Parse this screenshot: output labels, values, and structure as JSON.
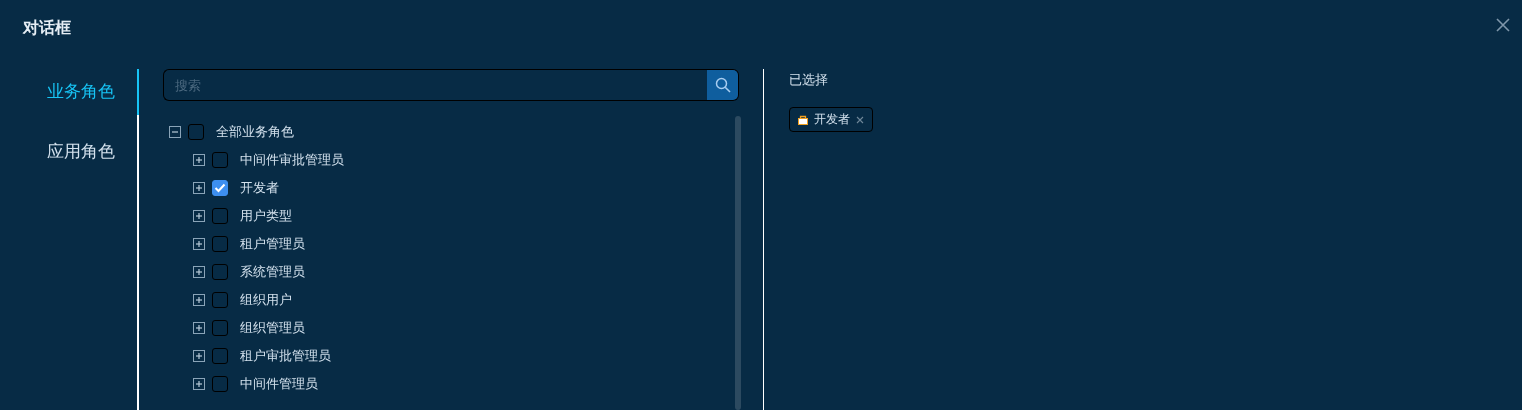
{
  "dialog": {
    "title": "对话框"
  },
  "nav": [
    {
      "label": "业务角色",
      "selected": true
    },
    {
      "label": "应用角色",
      "selected": false
    }
  ],
  "search": {
    "placeholder": "搜索"
  },
  "tree": [
    {
      "label": "全部业务角色",
      "expanded": true,
      "checked": false,
      "children": [
        {
          "label": "中间件审批管理员",
          "expanded": false,
          "checked": false
        },
        {
          "label": "开发者",
          "expanded": false,
          "checked": true
        },
        {
          "label": "用户类型",
          "expanded": false,
          "checked": false
        },
        {
          "label": "租户管理员",
          "expanded": false,
          "checked": false
        },
        {
          "label": "系统管理员",
          "expanded": false,
          "checked": false
        },
        {
          "label": "组织用户",
          "expanded": false,
          "checked": false
        },
        {
          "label": "组织管理员",
          "expanded": false,
          "checked": false
        },
        {
          "label": "租户审批管理员",
          "expanded": false,
          "checked": false
        },
        {
          "label": "中间件管理员",
          "expanded": false,
          "checked": false
        }
      ]
    }
  ],
  "selected_panel": {
    "title": "已选择",
    "tags": [
      {
        "label": "开发者"
      }
    ]
  }
}
